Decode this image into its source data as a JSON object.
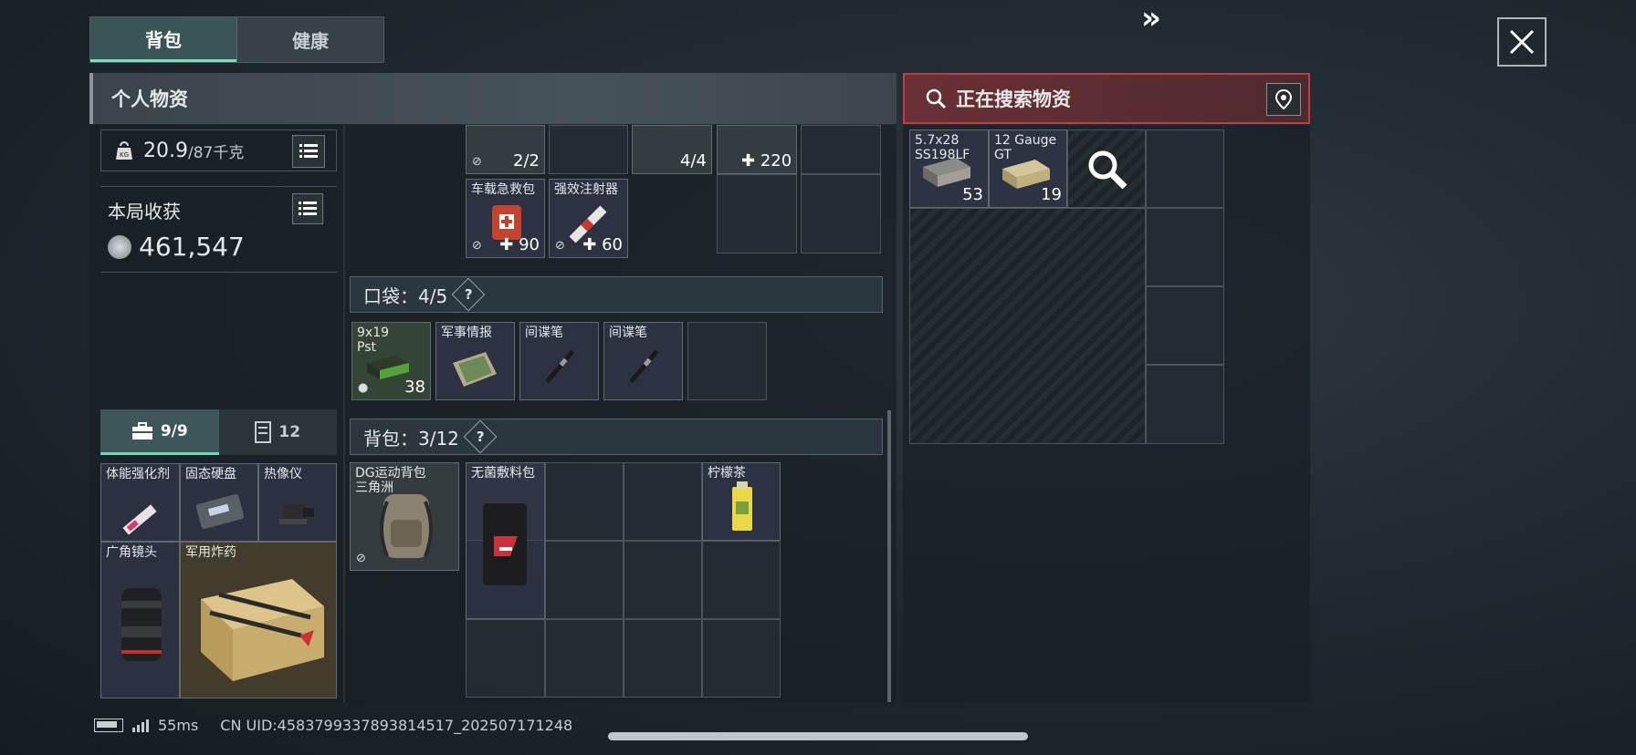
{
  "tabs": [
    "背包",
    "健康"
  ],
  "left_header": "个人物资",
  "right_header": "正在搜索物资",
  "weight": {
    "current": "20.9",
    "max": "/87千克"
  },
  "harvest": {
    "label": "本局收获",
    "value": "461,547"
  },
  "case_tabs": {
    "safe_box": "9/9",
    "storage": "12"
  },
  "top_items": [
    {
      "name": "",
      "count": "2/2"
    },
    {
      "name": "",
      "count": "4/4"
    },
    {
      "name": "",
      "count": "220"
    },
    {
      "name": "车载急救包",
      "count": "90"
    },
    {
      "name": "强效注射器",
      "count": "60"
    }
  ],
  "pocket": {
    "label": "口袋：4/5",
    "items": [
      {
        "name": "9x19\nPst",
        "count": "38"
      },
      {
        "name": "军事情报",
        "count": ""
      },
      {
        "name": "间谍笔",
        "count": ""
      },
      {
        "name": "间谍笔",
        "count": ""
      }
    ]
  },
  "backpack": {
    "label": "背包：3/12",
    "equipped": "DG运动背包\n三角洲",
    "items": [
      {
        "name": "无菌敷料包"
      },
      {
        "name": "柠檬茶"
      }
    ]
  },
  "safe_items": [
    {
      "name": "体能强化剂"
    },
    {
      "name": "固态硬盘"
    },
    {
      "name": "热像仪"
    },
    {
      "name": "广角镜头"
    },
    {
      "name": "军用炸药"
    }
  ],
  "search_items": [
    {
      "name": "5.7x28\nSS198LF",
      "count": "53"
    },
    {
      "name": "12 Gauge\nGT",
      "count": "19"
    }
  ],
  "status": {
    "ping": "55ms",
    "uid": "CN UID:4583799337893814517_202507171248"
  },
  "icons": [
    "close-icon",
    "search-icon",
    "location-pin-icon",
    "list-icon",
    "weight-icon",
    "coin-icon",
    "briefcase-icon",
    "cabinet-icon",
    "question-icon",
    "battery-icon",
    "signal-icon"
  ]
}
